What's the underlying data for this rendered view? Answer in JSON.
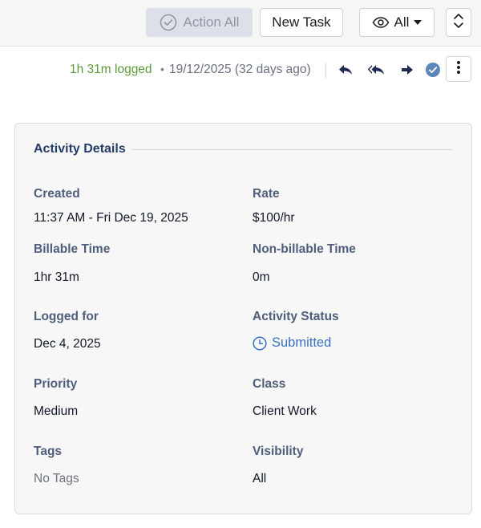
{
  "toolbar": {
    "action_all_label": "Action All",
    "new_task_label": "New Task",
    "filter_label": "All"
  },
  "meta": {
    "logged": "1h 31m logged",
    "separator_dot": "•",
    "date": "19/12/2025 (32 days ago)"
  },
  "details": {
    "title": "Activity Details",
    "created_label": "Created",
    "created_value": "11:37 AM - Fri Dec 19, 2025",
    "rate_label": "Rate",
    "rate_value": "$100/hr",
    "billable_label": "Billable Time",
    "billable_value": "1hr 31m",
    "nonbillable_label": "Non-billable Time",
    "nonbillable_value": "0m",
    "logged_for_label": "Logged for",
    "logged_for_value": "Dec 4, 2025",
    "status_label": "Activity Status",
    "status_value": "Submitted",
    "priority_label": "Priority",
    "priority_value": "Medium",
    "class_label": "Class",
    "class_value": "Client Work",
    "tags_label": "Tags",
    "tags_value": "No Tags",
    "visibility_label": "Visibility",
    "visibility_value": "All"
  },
  "colors": {
    "accent": "#3970c4",
    "logged_green": "#5d9a3c",
    "heading_navy": "#243c68"
  },
  "icons": [
    "check-circle-icon",
    "eye-icon",
    "caret-down-icon",
    "expand-icon",
    "reply-icon",
    "reply-all-icon",
    "forward-icon",
    "completed-check-icon",
    "more-vertical-icon",
    "clock-icon"
  ]
}
